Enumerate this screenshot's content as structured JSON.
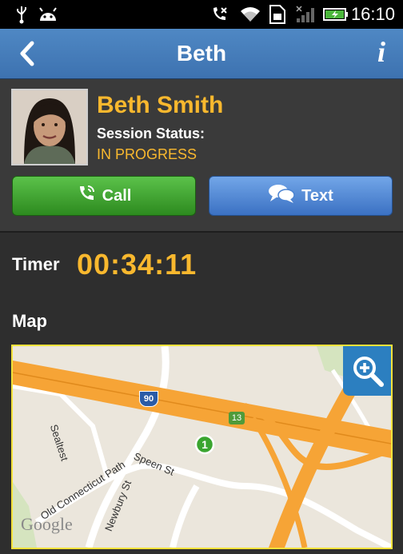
{
  "status_bar": {
    "time": "16:10",
    "icons": [
      "usb-icon",
      "android-icon",
      "mute-icon",
      "wifi-icon",
      "sim-icon",
      "signal-icon",
      "battery-icon"
    ]
  },
  "title_bar": {
    "title": "Beth",
    "back_icon": "chevron-left-icon",
    "info_icon": "info-icon"
  },
  "contact": {
    "name": "Beth Smith",
    "session_status_label": "Session Status:",
    "session_status_value": "IN PROGRESS"
  },
  "actions": {
    "call_label": "Call",
    "text_label": "Text"
  },
  "timer": {
    "label": "Timer",
    "value": "00:34:11"
  },
  "map": {
    "label": "Map",
    "streets": [
      "Sealtest",
      "Old Connecticut Path",
      "Speen St",
      "Newbury St"
    ],
    "highway_shield": "90",
    "exit_marker": "13",
    "pin_label": "1",
    "watermark": "Google",
    "zoom_icon": "zoom-in-icon"
  },
  "colors": {
    "accent": "#f9b82e",
    "title_bar": "#4479b9",
    "call_green": "#3fa42f",
    "text_blue": "#4c84d2",
    "map_border": "#f3e23a"
  }
}
